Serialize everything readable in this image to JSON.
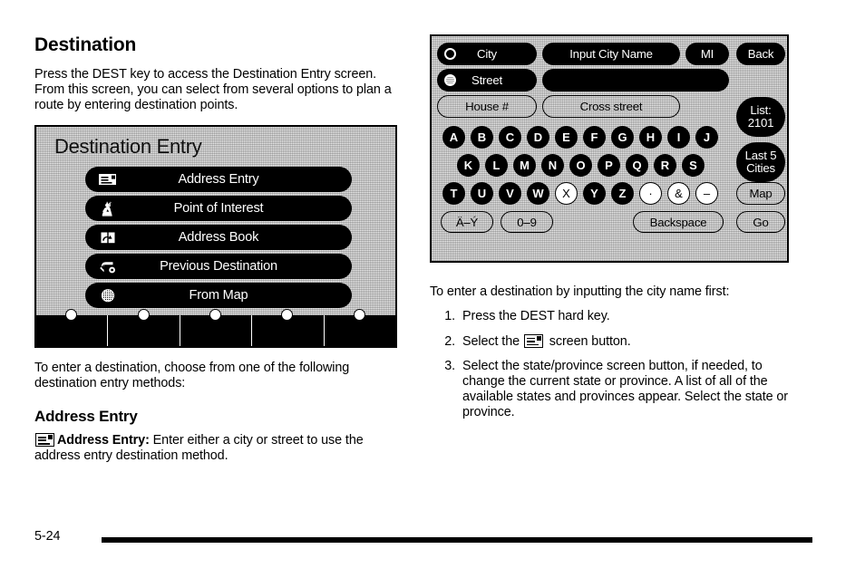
{
  "page": {
    "number": "5-24"
  },
  "left": {
    "heading": "Destination",
    "intro": "Press the DEST key to access the Destination Entry screen. From this screen, you can select from several options to plan a route by entering destination points.",
    "after_screen": "To enter a destination, choose from one of the following destination entry methods:",
    "subheading": "Address Entry",
    "address_entry_term": "Address Entry:",
    "address_entry_desc": " Enter either a city or street to use the address entry destination method."
  },
  "dest_screen": {
    "title": "Destination Entry",
    "menu": [
      {
        "label": "Address Entry",
        "icon": "envelope-card-icon"
      },
      {
        "label": "Point of Interest",
        "icon": "statue-of-liberty-icon"
      },
      {
        "label": "Address Book",
        "icon": "open-book-icon"
      },
      {
        "label": "Previous Destination",
        "icon": "u-turn-arrow-icon"
      },
      {
        "label": "From Map",
        "icon": "globe-icon"
      }
    ],
    "hard_buttons": 5
  },
  "kb_screen": {
    "city_label": "City",
    "city_selected": false,
    "street_label": "Street",
    "street_selected": true,
    "city_input_value": "Input City Name",
    "state_button": "MI",
    "street_input_value": "",
    "house_button": "House #",
    "cross_street_button": "Cross street",
    "back_button": "Back",
    "list_button_line1": "List:",
    "list_button_line2": "2101",
    "last5_line1": "Last 5",
    "last5_line2": "Cities",
    "map_button": "Map",
    "go_button": "Go",
    "accent_button": "Ä–Ý",
    "numeric_button": "0–9",
    "backspace_button": "Backspace",
    "keys_row1": [
      "A",
      "B",
      "C",
      "D",
      "E",
      "F",
      "G",
      "H",
      "I",
      "J"
    ],
    "keys_row2": [
      "K",
      "L",
      "M",
      "N",
      "O",
      "P",
      "Q",
      "R",
      "S"
    ],
    "keys_row3": [
      "T",
      "U",
      "V",
      "W",
      "X",
      "Y",
      "Z"
    ],
    "keys_row3_hollow": [
      "X"
    ],
    "symbol_keys": [
      "·",
      "&",
      "–"
    ]
  },
  "right": {
    "intro": "To enter a destination by inputting the city name first:",
    "steps": [
      {
        "num": "1.",
        "pre": "Press the DEST hard key.",
        "icon": null,
        "post": ""
      },
      {
        "num": "2.",
        "pre": "Select the ",
        "icon": "envelope-card-icon",
        "post": " screen button."
      },
      {
        "num": "3.",
        "pre": "Select the state/province screen button, if needed, to change the current state or province. A list of all of the available states and provinces appear. Select the state or province.",
        "icon": null,
        "post": ""
      }
    ]
  }
}
